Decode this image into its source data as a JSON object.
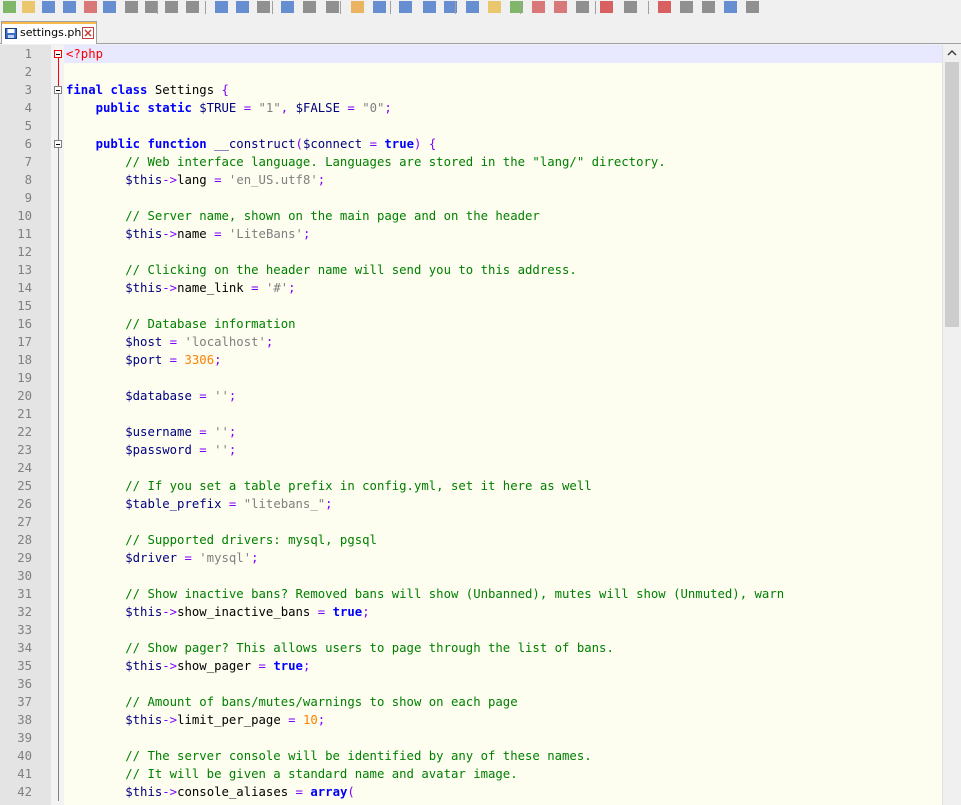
{
  "tab": {
    "label": "settings.php"
  },
  "icons": {
    "save": "floppy-disk-icon",
    "close": "close-icon",
    "fold": "fold-minus-icon",
    "scroll_up": "chevron-up-icon"
  },
  "colors": {
    "keyword": "#0000ff",
    "comment": "#008000",
    "string": "#808080",
    "number": "#ff8000",
    "php_tag": "#ff0000",
    "editor_bg": "#fdfdf0",
    "current_line": "#e8e8ff"
  },
  "lines": [
    "<?php",
    "",
    "final class Settings {",
    "    public static $TRUE = \"1\", $FALSE = \"0\";",
    "",
    "    public function __construct($connect = true) {",
    "        // Web interface language. Languages are stored in the \"lang/\" directory.",
    "        $this->lang = 'en_US.utf8';",
    "",
    "        // Server name, shown on the main page and on the header",
    "        $this->name = 'LiteBans';",
    "",
    "        // Clicking on the header name will send you to this address.",
    "        $this->name_link = '#';",
    "",
    "        // Database information",
    "        $host = 'localhost';",
    "        $port = 3306;",
    "",
    "        $database = '';",
    "",
    "        $username = '';",
    "        $password = '';",
    "",
    "        // If you set a table prefix in config.yml, set it here as well",
    "        $table_prefix = \"litebans_\";",
    "",
    "        // Supported drivers: mysql, pgsql",
    "        $driver = 'mysql';",
    "",
    "        // Show inactive bans? Removed bans will show (Unbanned), mutes will show (Unmuted), warn",
    "        $this->show_inactive_bans = true;",
    "",
    "        // Show pager? This allows users to page through the list of bans.",
    "        $this->show_pager = true;",
    "",
    "        // Amount of bans/mutes/warnings to show on each page",
    "        $this->limit_per_page = 10;",
    "",
    "        // The server console will be identified by any of these names.",
    "        // It will be given a standard name and avatar image.",
    "        $this->console_aliases = array("
  ],
  "line_numbers": [
    "1",
    "2",
    "3",
    "4",
    "5",
    "6",
    "7",
    "8",
    "9",
    "10",
    "11",
    "12",
    "13",
    "14",
    "15",
    "16",
    "17",
    "18",
    "19",
    "20",
    "21",
    "22",
    "23",
    "24",
    "25",
    "26",
    "27",
    "28",
    "29",
    "30",
    "31",
    "32",
    "33",
    "34",
    "35",
    "36",
    "37",
    "38",
    "39",
    "40",
    "41",
    "42"
  ]
}
